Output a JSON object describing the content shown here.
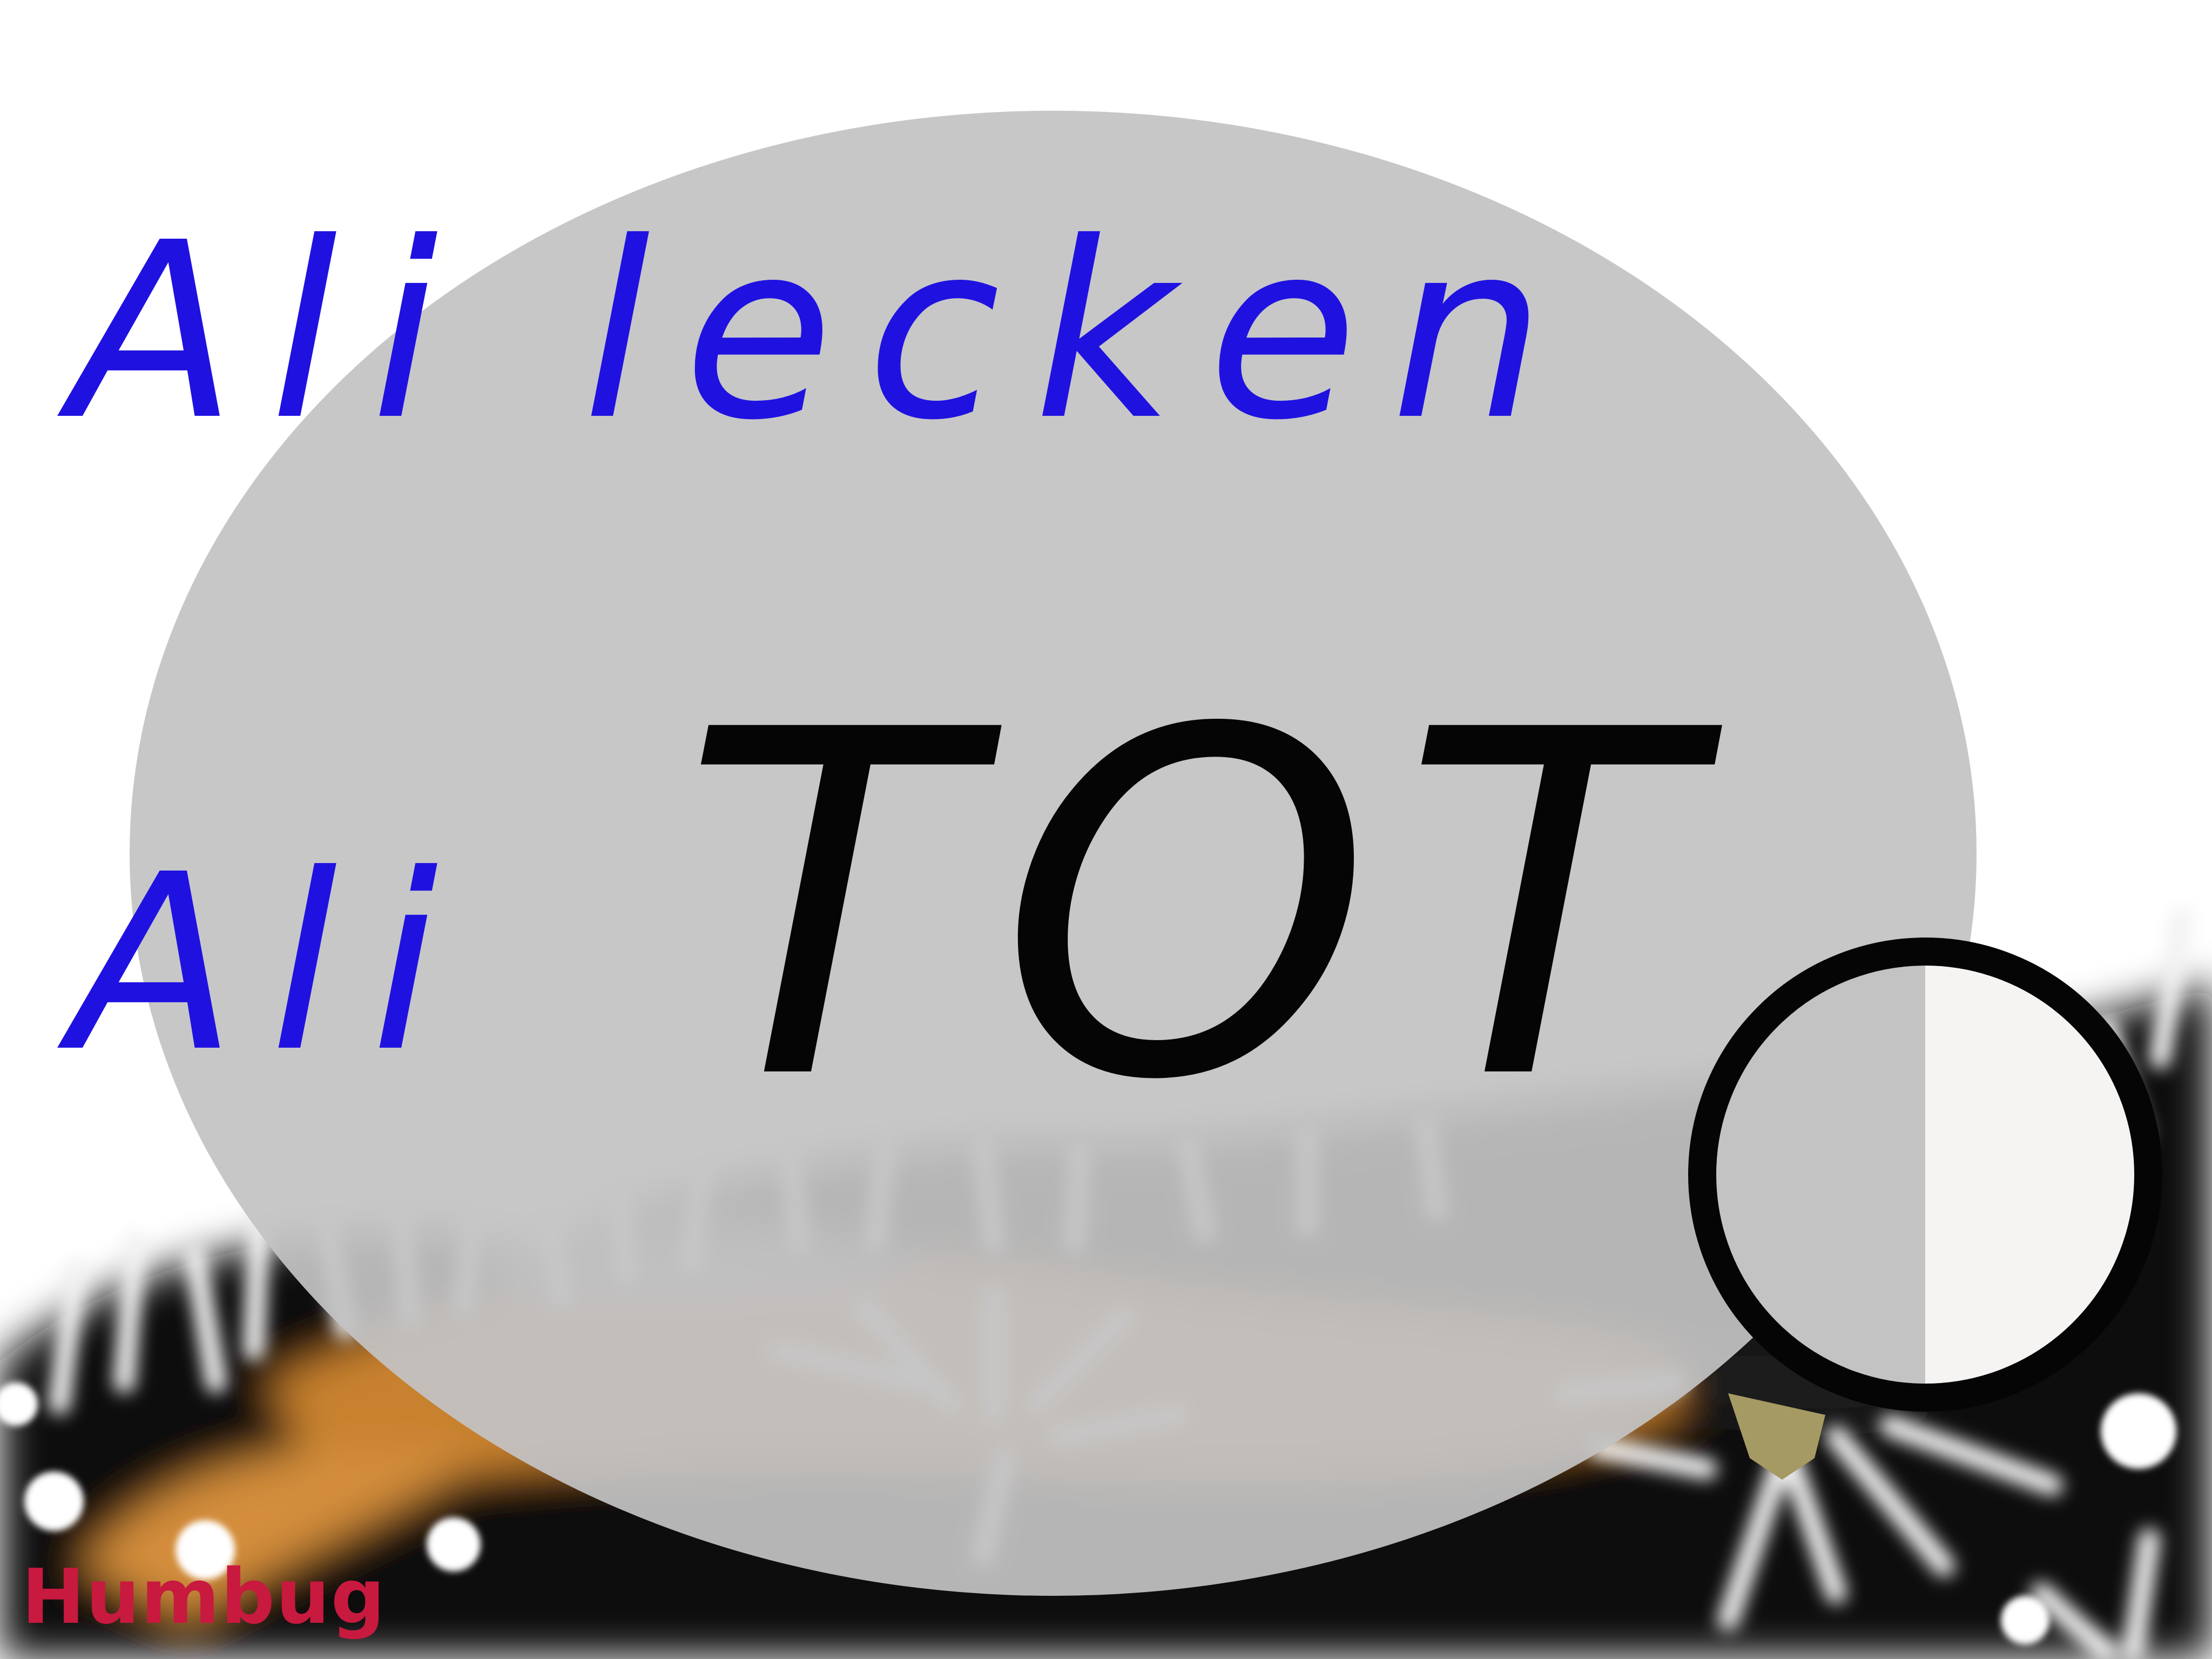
{
  "colors": {
    "background": "#ffffff",
    "ellipse_fill": "#c3c3c4",
    "text_blue": "#1f12e0",
    "text_black": "#050505",
    "watermark": "#c8193f",
    "fur_black": "#0a0a0a",
    "fur_white": "#f0f0f0",
    "fur_orange": "#c8812e",
    "ring": "#050505",
    "lens_left": "#c3c3c4",
    "lens_right": "#f6f4f3"
  },
  "text": {
    "line1": "Ali lecken",
    "line2_prefix": "Ali",
    "line2_main": "TOT",
    "watermark": "Humbug"
  },
  "icons": {
    "magnifier": "magnifier-icon"
  }
}
